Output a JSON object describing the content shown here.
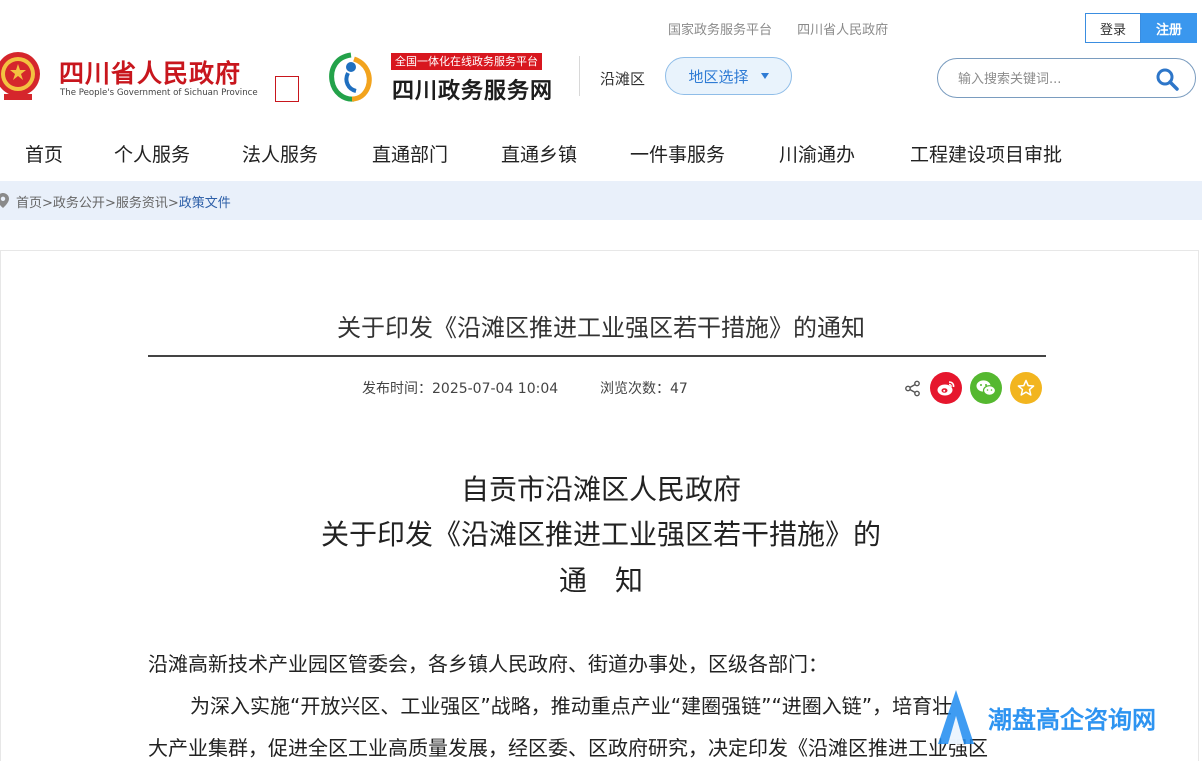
{
  "top_links": [
    "国家政务服务平台",
    "四川省人民政府"
  ],
  "auth": {
    "login": "登录",
    "register": "注册"
  },
  "brand": {
    "gov_title": "四川省人民政府",
    "gov_subtitle": "The People's Government of Sichuan Province",
    "service_tag": "全国一体化在线政务服务平台",
    "service_title": "四川政务服务网"
  },
  "region": {
    "current": "沿滩区",
    "select_label": "地区选择"
  },
  "search": {
    "placeholder": "输入搜索关键词..."
  },
  "nav": [
    {
      "label": "首页"
    },
    {
      "label": "个人服务"
    },
    {
      "label": "法人服务"
    },
    {
      "label": "直通部门"
    },
    {
      "label": "直通乡镇"
    },
    {
      "label": "一件事服务"
    },
    {
      "label": "川渝通办"
    },
    {
      "label": "工程建设项目审批"
    }
  ],
  "breadcrumb": {
    "items": [
      "首页",
      "政务公开",
      "服务资讯"
    ],
    "separator": ">",
    "current": "政策文件"
  },
  "article": {
    "title": "关于印发《沿滩区推进工业强区若干措施》的通知",
    "publish_label": "发布时间：",
    "publish_time": "2025-07-04 10:04",
    "views_label": "浏览次数：",
    "views": "47",
    "doc_issuer": "自贡市沿滩区人民政府",
    "doc_title_line": "关于印发《沿滩区推进工业强区若干措施》的",
    "doc_title_end": "通　知",
    "addressee": "沿滩高新技术产业园区管委会，各乡镇人民政府、街道办事处，区级各部门：",
    "para1_line1": "为深入实施“开放兴区、工业强区”战略，推动重点产业“建圈强链”“进圈入链”，培育壮",
    "para1_line2": "大产业集群，促进全区工业高质量发展，经区委、区政府研究，决定印发《沿滩区推进工业强区"
  },
  "watermark": {
    "text": "潮盘高企咨询网"
  },
  "colors": {
    "gov_red": "#c8161d",
    "accent_blue": "#3a97ee",
    "crumb_bg": "#e9f0fa"
  }
}
